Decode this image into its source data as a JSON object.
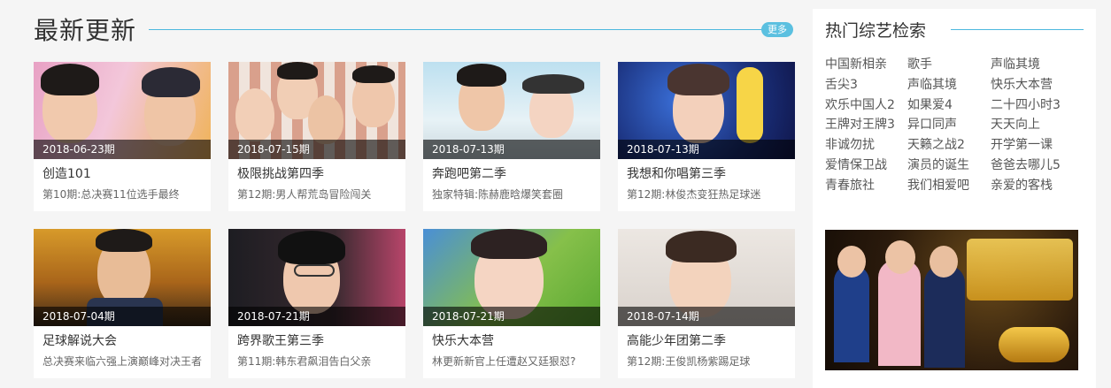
{
  "section": {
    "title": "最新更新",
    "more_label": "更多"
  },
  "cards": [
    {
      "date": "2018-06-23期",
      "title": "创造101",
      "subtitle": "第10期:总决赛11位选手最终"
    },
    {
      "date": "2018-07-15期",
      "title": "极限挑战第四季",
      "subtitle": "第12期:男人帮荒岛冒险闯关"
    },
    {
      "date": "2018-07-13期",
      "title": "奔跑吧第二季",
      "subtitle": "独家特辑:陈赫鹿晗爆笑套圈"
    },
    {
      "date": "2018-07-13期",
      "title": "我想和你唱第三季",
      "subtitle": "第12期:林俊杰变狂热足球迷"
    },
    {
      "date": "2018-07-04期",
      "title": "足球解说大会",
      "subtitle": "总决赛来临六强上演巅峰对决王者"
    },
    {
      "date": "2018-07-21期",
      "title": "跨界歌王第三季",
      "subtitle": "第11期:韩东君飙泪告白父亲"
    },
    {
      "date": "2018-07-21期",
      "title": "快乐大本营",
      "subtitle": "林更新新官上任遭赵又廷狠怼?"
    },
    {
      "date": "2018-07-14期",
      "title": "高能少年团第二季",
      "subtitle": "第12期:王俊凯杨紫踢足球"
    }
  ],
  "sidebar": {
    "title": "热门综艺检索",
    "items": [
      "中国新相亲",
      "歌手",
      "声临其境",
      "舌尖3",
      "声临其境",
      "快乐大本营",
      "欢乐中国人2",
      "如果爱4",
      "二十四小时3",
      "王牌对王牌3",
      "异口同声",
      "天天向上",
      "非诚勿扰",
      "天籁之战2",
      "开学第一课",
      "爱情保卫战",
      "演员的诞生",
      "爸爸去哪儿5",
      "青春旅社",
      "我们相爱吧",
      "亲爱的客栈"
    ]
  },
  "colors": {
    "accent": "#4cb8de",
    "date_overlay": "rgba(0,0,0,0.6)",
    "page_bg": "#f5f5f5"
  }
}
